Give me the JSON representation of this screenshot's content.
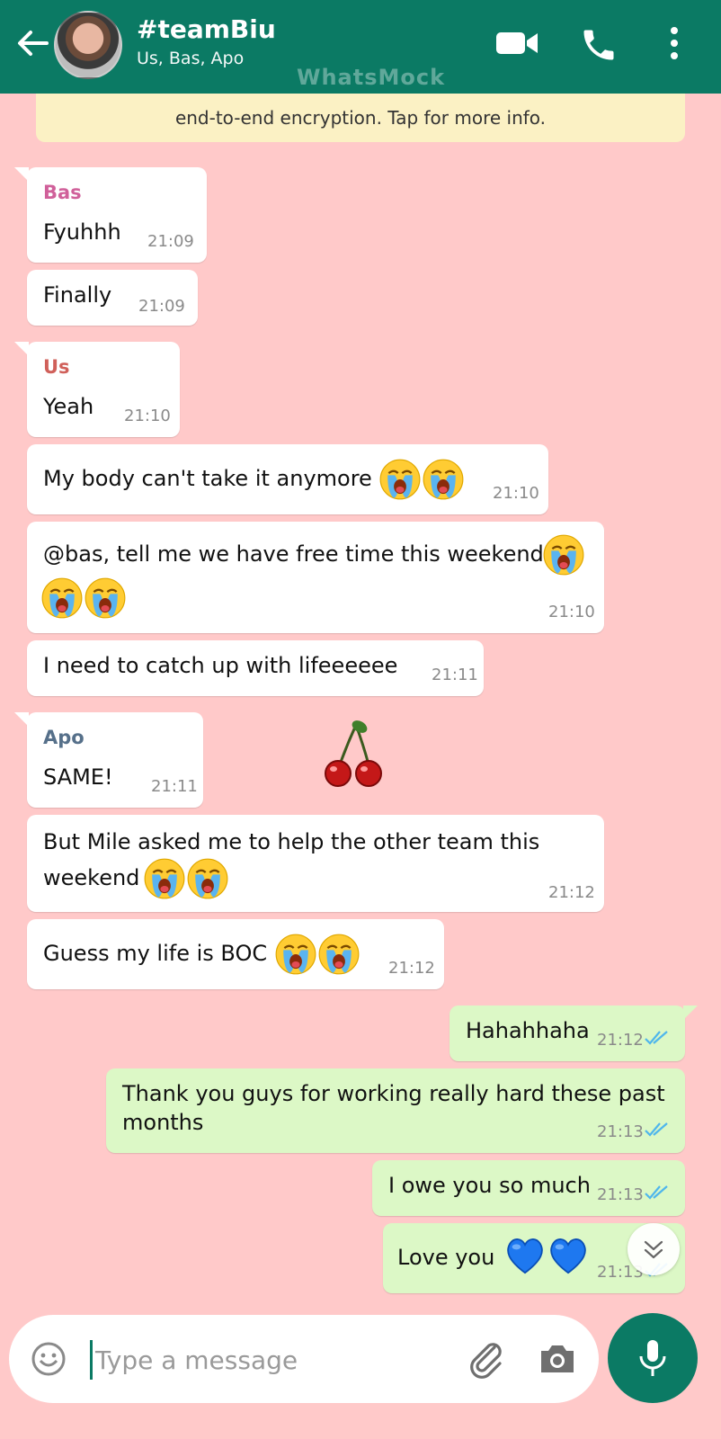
{
  "header": {
    "title": "#teamBiu",
    "subtitle": "Us, Bas, Apo",
    "watermark": "WhatsMock"
  },
  "notice": {
    "text": "end-to-end encryption. Tap for more info."
  },
  "colors": {
    "header_bg": "#0b7a64",
    "chat_bg": "#ffc9c9",
    "incoming_bubble": "#ffffff",
    "outgoing_bubble": "#dcf8c6",
    "sender_bas": "#d0609a",
    "sender_us": "#d0605a",
    "sender_apo": "#56708a",
    "read_ticks": "#4fb6ec"
  },
  "messages": [
    {
      "sender": "Bas",
      "text": "Fyuhhh",
      "time": "21:09"
    },
    {
      "text": "Finally",
      "time": "21:09"
    },
    {
      "sender": "Us",
      "text": "Yeah",
      "time": "21:10"
    },
    {
      "text": "My body can't take it anymore",
      "time": "21:10",
      "emoji": [
        "crying-face",
        "crying-face"
      ]
    },
    {
      "text": "@bas, tell me we have free time this weekend",
      "time": "21:10",
      "emoji": [
        "crying-face",
        "crying-face",
        "crying-face"
      ]
    },
    {
      "text": "I need to catch up with lifeeeeee",
      "time": "21:11"
    },
    {
      "sender": "Apo",
      "text": "SAME!",
      "time": "21:11"
    },
    {
      "text_line1": "But Mile asked me to help the other team this",
      "text_line2": "weekend",
      "time": "21:12",
      "emoji": [
        "crying-face",
        "crying-face"
      ]
    },
    {
      "text": "Guess my life is BOC",
      "time": "21:12",
      "emoji": [
        "crying-face",
        "crying-face"
      ]
    },
    {
      "text": "Hahahhaha",
      "time": "21:12",
      "outgoing": true
    },
    {
      "text_line1": "Thank you guys for working really hard these past",
      "text_line2": "months",
      "time": "21:13",
      "outgoing": true
    },
    {
      "text": "I owe you so much",
      "time": "21:13",
      "outgoing": true
    },
    {
      "text": "Love you",
      "time": "21:13",
      "outgoing": true,
      "emoji": [
        "blue-heart",
        "blue-heart"
      ]
    }
  ],
  "input": {
    "placeholder": "Type a message"
  }
}
